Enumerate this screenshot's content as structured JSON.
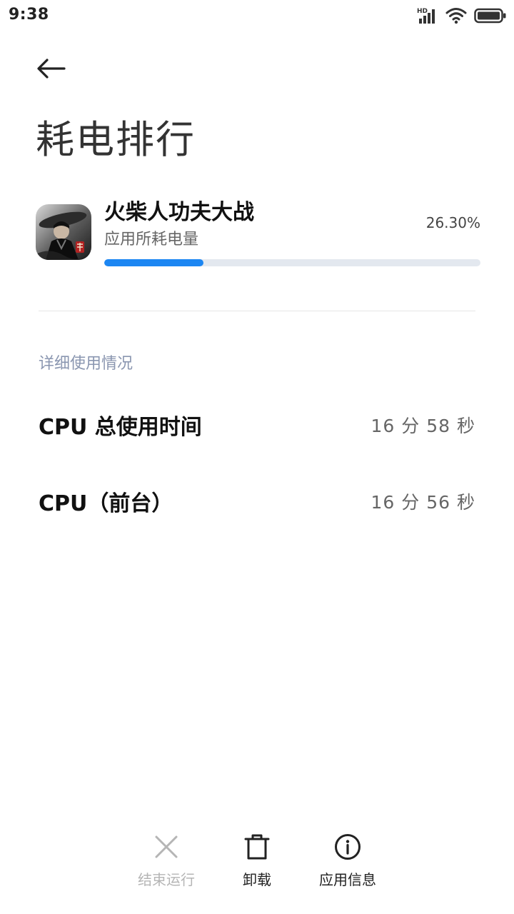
{
  "status_bar": {
    "time": "9:38",
    "icons": [
      "hd-signal-icon",
      "wifi-icon",
      "battery-icon"
    ],
    "network_badge": "HD"
  },
  "header": {
    "back_icon": "back-arrow-icon",
    "title": "耗电排行"
  },
  "app": {
    "name": "火柴人功夫大战",
    "subtitle": "应用所耗电量",
    "percent_text": "26.30%",
    "percent_value": 0.263
  },
  "details": {
    "section_title": "详细使用情况",
    "rows": [
      {
        "label": "CPU 总使用时间",
        "value": "16 分 58 秒"
      },
      {
        "label": "CPU（前台）",
        "value": "16 分 56 秒"
      }
    ]
  },
  "actions": [
    {
      "label": "结束运行",
      "icon": "close-icon",
      "enabled": false
    },
    {
      "label": "卸载",
      "icon": "trash-icon",
      "enabled": true
    },
    {
      "label": "应用信息",
      "icon": "info-icon",
      "enabled": true
    }
  ],
  "colors": {
    "accent": "#1c86f2",
    "track": "#e3e8ef",
    "section_header": "#8a96b0",
    "disabled": "#b5b5b5",
    "enabled": "#222222"
  }
}
